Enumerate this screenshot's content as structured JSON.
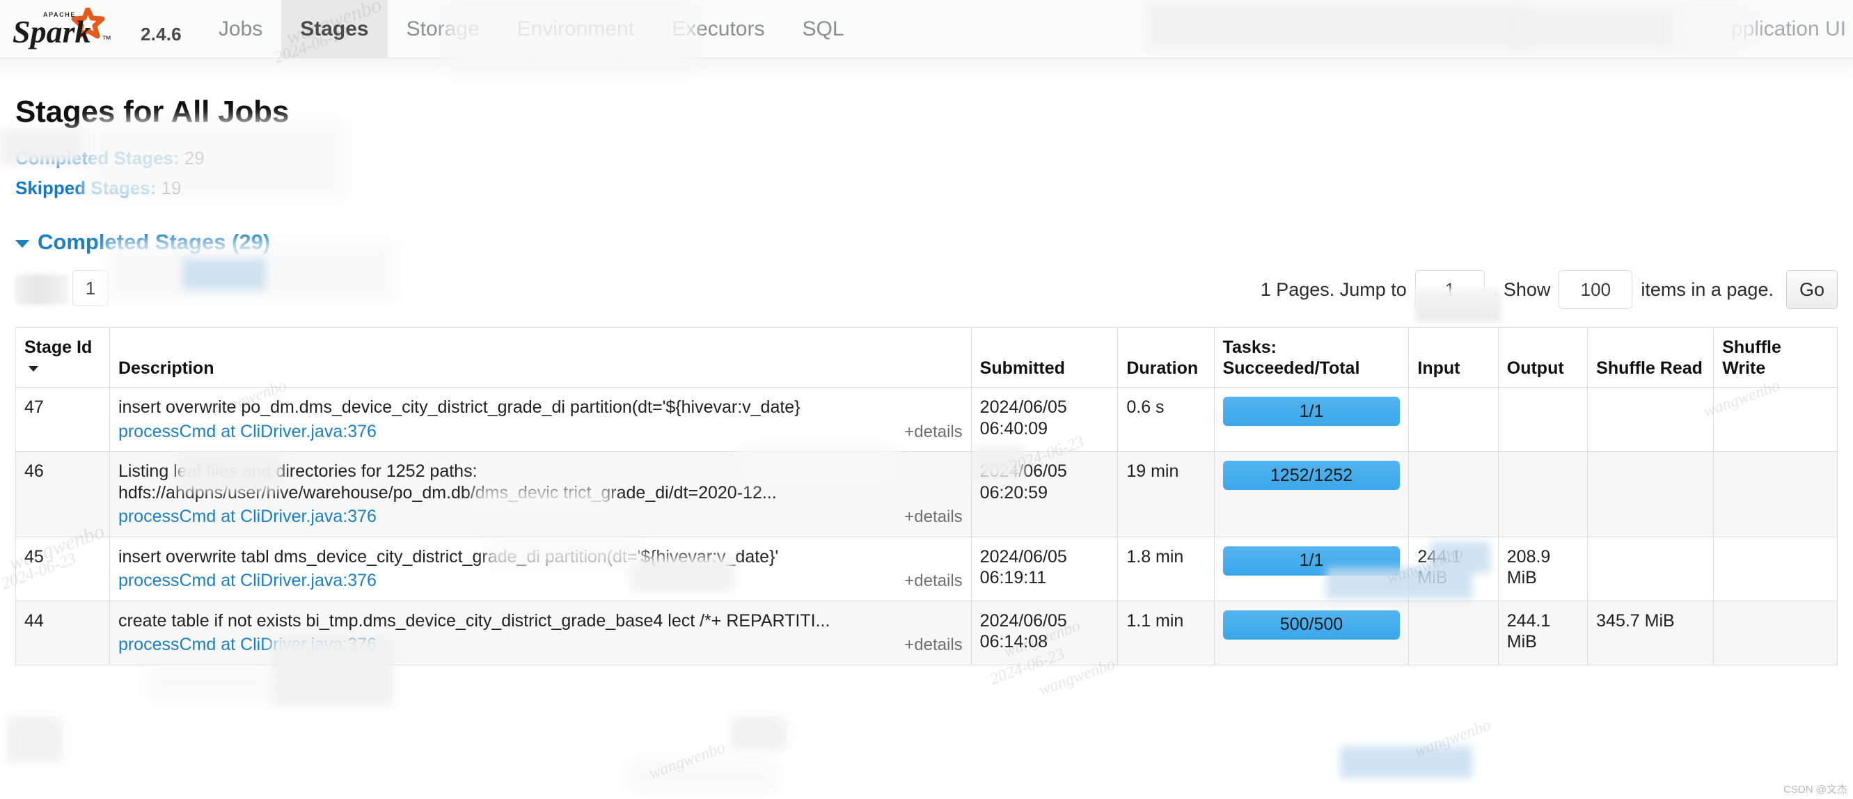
{
  "navbar": {
    "brand_name": "Apache Spark",
    "version": "2.4.6",
    "items": [
      {
        "label": "Jobs",
        "active": false
      },
      {
        "label": "Stages",
        "active": true
      },
      {
        "label": "Storage",
        "active": false
      },
      {
        "label": "Environment",
        "active": false
      },
      {
        "label": "Executors",
        "active": false
      },
      {
        "label": "SQL",
        "active": false
      }
    ],
    "right_label": "pplication UI"
  },
  "page": {
    "title": "Stages for All Jobs",
    "completed_label": "Completed Stages:",
    "completed_value": "29",
    "skipped_label": "Skipped Stages:",
    "skipped_value": "19",
    "section_title": "Completed Stages (29)"
  },
  "pagination": {
    "current_page": "1",
    "pages_text": "1 Pages. Jump to",
    "jump_value": "1",
    "show_text": ". Show",
    "page_size": "100",
    "items_text": "items in a page.",
    "go_label": "Go"
  },
  "table": {
    "headers": {
      "stage_id": "Stage Id",
      "description": "Description",
      "submitted": "Submitted",
      "duration": "Duration",
      "tasks_top": "Tasks:",
      "tasks_bottom": "Succeeded/Total",
      "input": "Input",
      "output": "Output",
      "shuffle_read": "Shuffle Read",
      "shuffle_write": "Shuffle Write"
    },
    "details_label": "+details",
    "rows": [
      {
        "id": "47",
        "desc_line1": "insert overwrite       po_dm.dms_device_city_district_grade_di partition(dt='${hivevar:v_date}",
        "desc_line2": "",
        "desc_line3": "",
        "link": "processCmd at CliDriver.java:376",
        "submitted_date": "2024/06/05",
        "submitted_time": "06:40:09",
        "duration": "0.6 s",
        "tasks": "1/1",
        "tasks_pct": 100,
        "input": "",
        "output": "",
        "shuffle_read": "",
        "shuffle_write": ""
      },
      {
        "id": "46",
        "desc_line1": "Listing leaf files and directories for 1252 paths:",
        "desc_line2": "hdfs://ahdpns/user/hive/warehouse/po_dm.db/dms_devic         trict_grade_di/dt=2020-12...",
        "desc_line3": "",
        "link": "processCmd at CliDriver.java:376",
        "submitted_date": "2024/06/05",
        "submitted_time": "06:20:59",
        "duration": "19 min",
        "tasks": "1252/1252",
        "tasks_pct": 100,
        "input": "",
        "output": "",
        "shuffle_read": "",
        "shuffle_write": ""
      },
      {
        "id": "45",
        "desc_line1": "insert overwrite tabl           dms_device_city_district_grade_di partition(dt='${hivevar:v_date}'",
        "desc_line2": "",
        "desc_line3": "",
        "link": "processCmd at CliDriver.java:376",
        "submitted_date": "2024/06/05",
        "submitted_time": "06:19:11",
        "duration": "1.8 min",
        "tasks": "1/1",
        "tasks_pct": 100,
        "input": "244.1 MiB",
        "output": "208.9 MiB",
        "shuffle_read": "",
        "shuffle_write": ""
      },
      {
        "id": "44",
        "desc_line1": "create table if not exists bi_tmp.dms_device_city_district_grade_base4      lect /*+ REPARTITI...",
        "desc_line2": "",
        "desc_line3": "",
        "link": "processCmd at CliDriver.java:376",
        "submitted_date": "2024/06/05",
        "submitted_time": "06:14:08",
        "duration": "1.1 min",
        "tasks": "500/500",
        "tasks_pct": 100,
        "input": "",
        "output": "244.1 MiB",
        "shuffle_read": "345.7 MiB",
        "shuffle_write": ""
      }
    ]
  },
  "watermarks": [
    "wangwenbo",
    "2024-06-23"
  ],
  "credit": "CSDN @文杰",
  "colors": {
    "accent_blue": "#1b7fc4",
    "progress_blue": "#3aa7ea",
    "nav_active_bg": "#e8e8e8",
    "logo_orange": "#e25a1c"
  }
}
